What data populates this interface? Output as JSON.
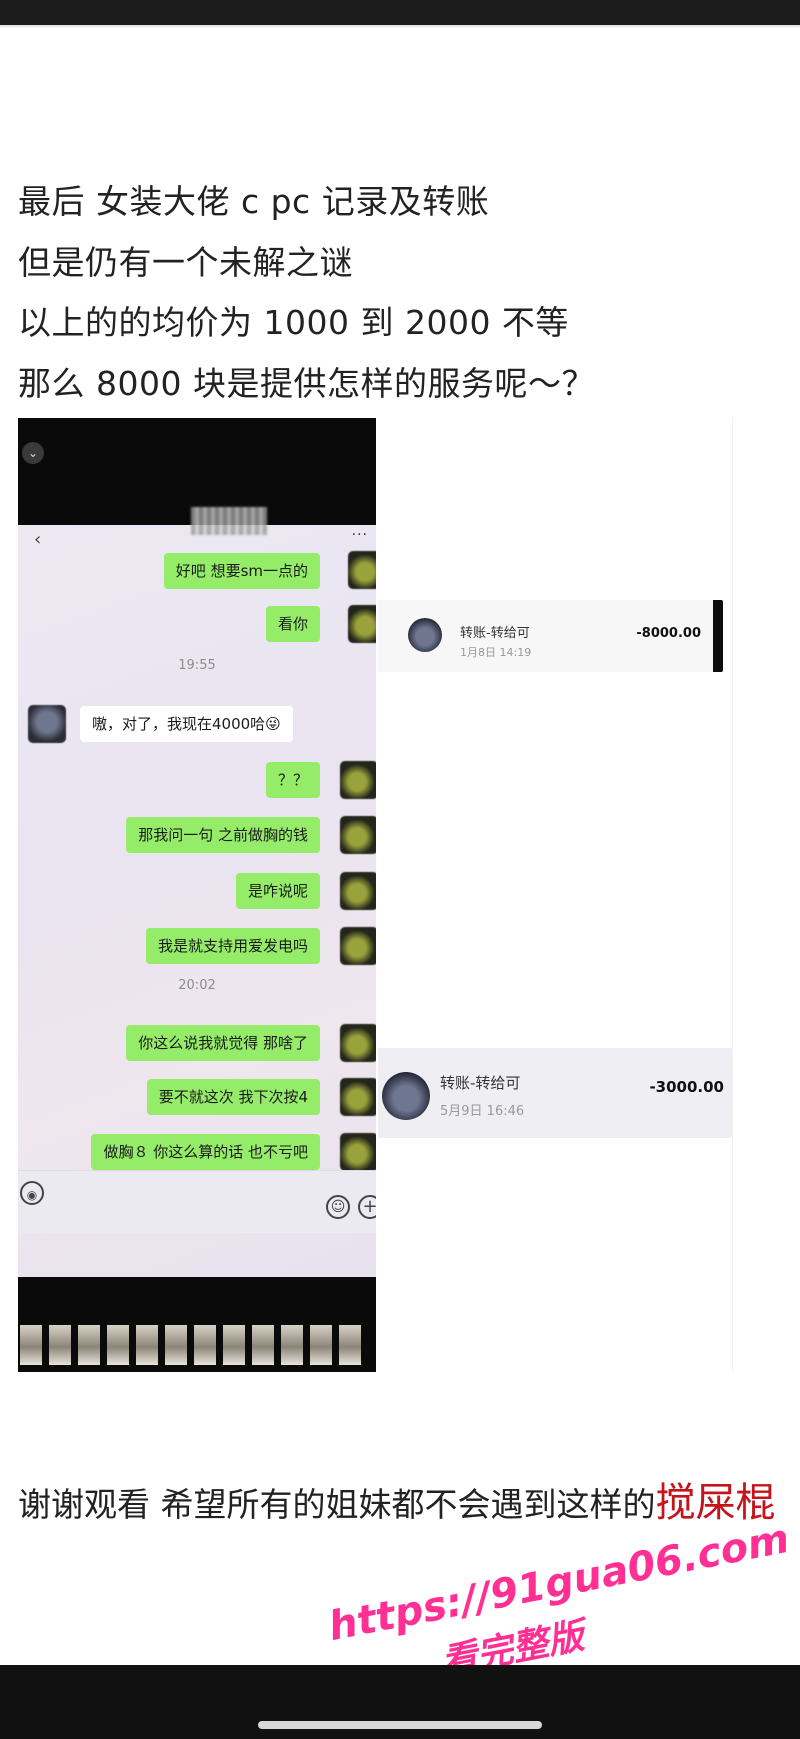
{
  "intro_lines": [
    "最后  女装大佬 c    pc 记录及转账",
    "但是仍有一个未解之谜",
    "以上的的均价为 1000 到 2000 不等",
    "那么 8000 块是提供怎样的服务呢～？"
  ],
  "chat": {
    "messages": [
      {
        "side": "right",
        "text": "好吧 想要sm一点的"
      },
      {
        "side": "right",
        "text": "看你"
      },
      {
        "side": "left",
        "text": "嗷，对了，我现在4000哈😜"
      },
      {
        "side": "right",
        "text": "？？"
      },
      {
        "side": "right",
        "text": "那我问一句 之前做胸的钱"
      },
      {
        "side": "right",
        "text": "是咋说呢"
      },
      {
        "side": "right",
        "text": "我是就支持用爱发电吗"
      },
      {
        "side": "right",
        "text": "你这么说我就觉得 那啥了"
      },
      {
        "side": "right",
        "text": "要不就这次 我下次按4"
      },
      {
        "side": "right",
        "text": "做胸８ 你这么算的话 也不亏吧"
      }
    ],
    "timestamps": [
      "19:55",
      "20:02"
    ]
  },
  "transfers": [
    {
      "title": "转账-转给可",
      "date": "1月8日 14:19",
      "amount": "-8000.00"
    },
    {
      "title": "转账-转给可",
      "date": "5月9日 16:46",
      "amount": "-3000.00"
    }
  ],
  "closing": {
    "text": "谢谢观看  希望所有的姐妹都不会遇到这样的",
    "highlight": "搅屎棍"
  },
  "watermark": {
    "url": "https://91gua06.com",
    "sub": "看完整版",
    "color": "#ff2f93"
  }
}
